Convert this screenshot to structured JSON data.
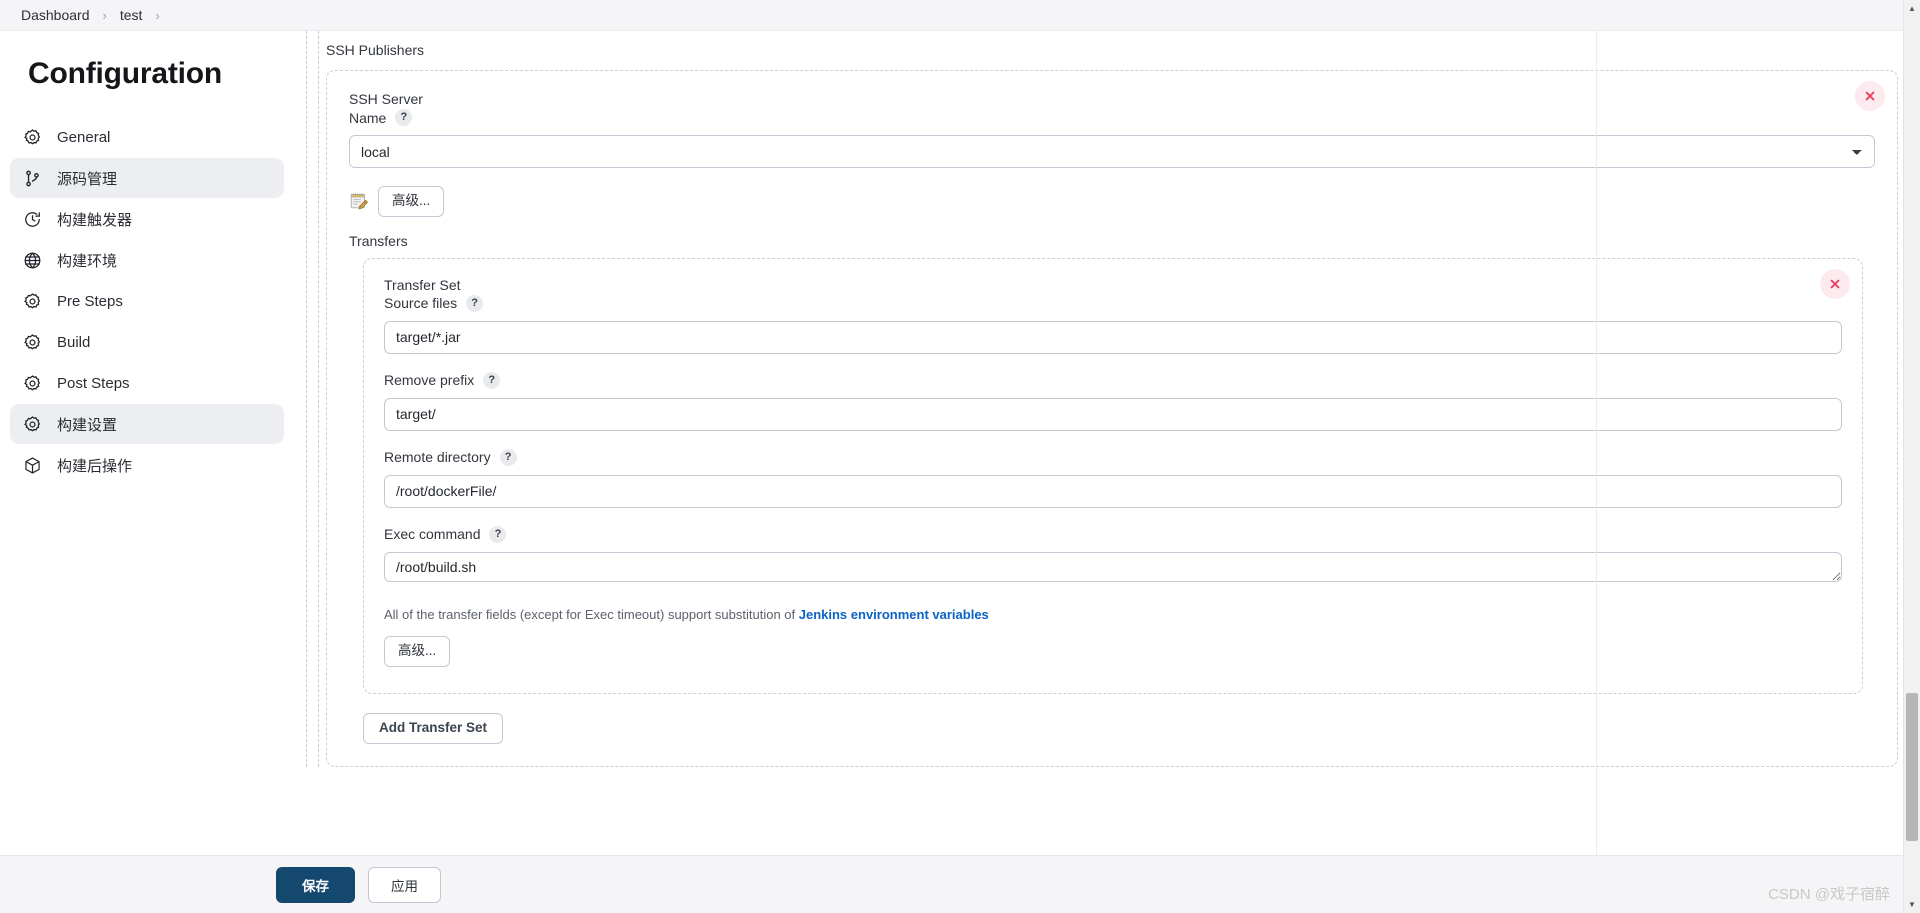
{
  "breadcrumb": {
    "items": [
      {
        "label": "Dashboard"
      },
      {
        "label": "test"
      }
    ],
    "separator": "›"
  },
  "sidebar": {
    "title": "Configuration",
    "items": [
      {
        "label": "General",
        "icon": "gear-icon",
        "active": false
      },
      {
        "label": "源码管理",
        "icon": "branch-icon",
        "active": true
      },
      {
        "label": "构建触发器",
        "icon": "clock-icon",
        "active": false
      },
      {
        "label": "构建环境",
        "icon": "globe-icon",
        "active": false
      },
      {
        "label": "Pre Steps",
        "icon": "gear-icon",
        "active": false
      },
      {
        "label": "Build",
        "icon": "gear-icon",
        "active": false
      },
      {
        "label": "Post Steps",
        "icon": "gear-icon",
        "active": false
      },
      {
        "label": "构建设置",
        "icon": "gear-icon",
        "active": true
      },
      {
        "label": "构建后操作",
        "icon": "package-icon",
        "active": false
      }
    ]
  },
  "main": {
    "section_label": "SSH Publishers",
    "server": {
      "title": "SSH Server",
      "name_label": "Name",
      "help": "?",
      "selected": "local",
      "options": [
        "local"
      ],
      "delete_title": "删除",
      "advanced_label": "高级...",
      "notepad_icon": "notepad-icon"
    },
    "transfers": {
      "label": "Transfers",
      "transfer_set": {
        "title": "Transfer Set",
        "delete_title": "删除",
        "fields": [
          {
            "label": "Source files",
            "help": "?",
            "value": "target/*.jar",
            "type": "text"
          },
          {
            "label": "Remove prefix",
            "help": "?",
            "value": "target/",
            "type": "text"
          },
          {
            "label": "Remote directory",
            "help": "?",
            "value": "/root/dockerFile/",
            "type": "text"
          },
          {
            "label": "Exec command",
            "help": "?",
            "value": "/root/build.sh",
            "type": "textarea"
          }
        ],
        "note_prefix": "All of the transfer fields (except for Exec timeout) support substitution of ",
        "note_link": "Jenkins environment variables",
        "advanced_label": "高级..."
      },
      "add_button": "Add Transfer Set"
    }
  },
  "footer": {
    "save": "保存",
    "apply": "应用"
  },
  "watermark": "CSDN @戏子宿醉",
  "colors": {
    "accent": "#14486f",
    "link": "#0b63c5",
    "danger": "#e5405e",
    "active_nav": "#eceef2"
  }
}
